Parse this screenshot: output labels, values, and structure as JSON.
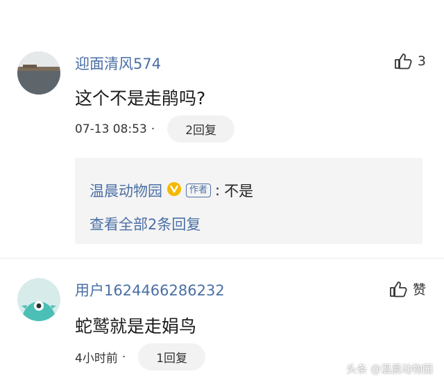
{
  "comments": [
    {
      "username": "迎面清风574",
      "likes": "3",
      "content": "这个不是走鹃吗?",
      "time": "07-13 08:53",
      "dot": "·",
      "reply_button": "2回复",
      "reply_preview": {
        "author": "温晨动物园",
        "author_tag": "作者",
        "separator": ":",
        "text": "不是",
        "view_all": "查看全部2条回复"
      }
    },
    {
      "username": "用户1624466286232",
      "like_label": "赞",
      "content": "蛇鹫就是走娟鸟",
      "time": "4小时前",
      "dot": "·",
      "reply_button": "1回复"
    }
  ],
  "watermark": "头条 @温晨动物园",
  "colors": {
    "username": "#4a6fa5",
    "verified_badge": "#f5b800",
    "pill_bg": "#f2f2f2",
    "reply_box_bg": "#f4f4f4"
  },
  "icons": {
    "like": "thumbs-up-icon",
    "verified": "verified-v-badge-icon",
    "avatar2": "green-monster-avatar"
  }
}
